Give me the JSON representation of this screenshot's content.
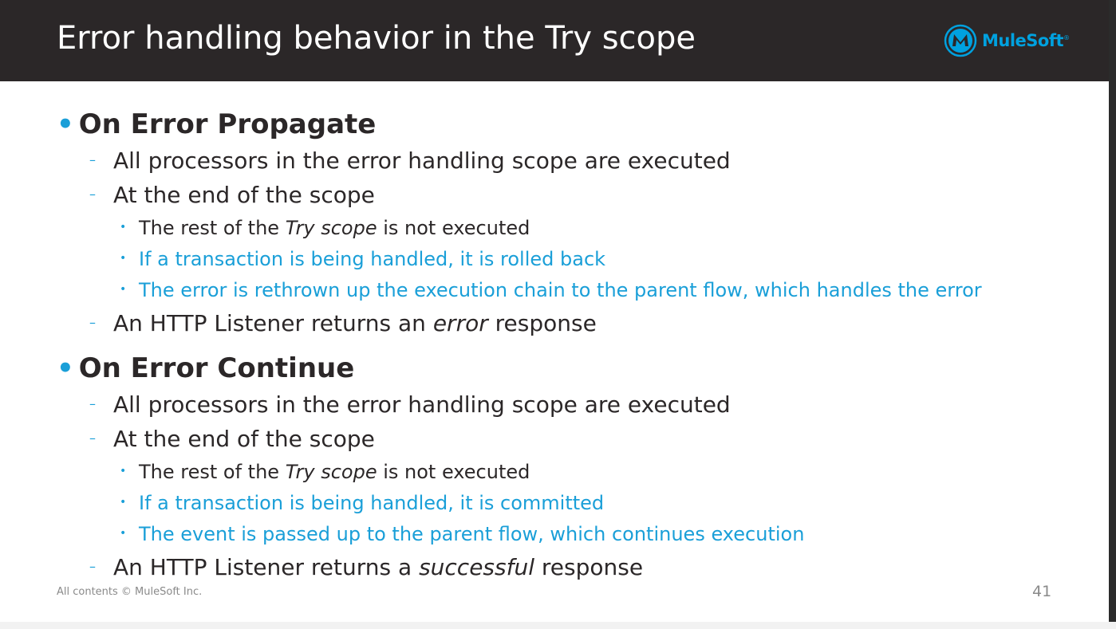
{
  "slide": {
    "title": "Error handling behavior in the Try scope",
    "logo_text": "MuleSoft",
    "footer": "All contents © MuleSoft Inc.",
    "page_number": "41"
  },
  "propagate": {
    "heading": "On Error Propagate",
    "item1": "All processors in the error handling scope are executed",
    "item2": "At the end of the scope",
    "sub1_pre": "The rest of the ",
    "sub1_em": "Try scope",
    "sub1_post": " is not executed",
    "sub2": "If a transaction is being handled, it is rolled back",
    "sub3": "The error is rethrown up the execution chain to the parent flow, which handles the error",
    "item3_pre": "An HTTP Listener returns an ",
    "item3_em": "error",
    "item3_post": " response"
  },
  "continue": {
    "heading": "On Error Continue",
    "item1": "All processors in the error handling scope are executed",
    "item2": "At the end of the scope",
    "sub1_pre": "The rest of the ",
    "sub1_em": "Try scope",
    "sub1_post": " is not executed",
    "sub2": "If a transaction is being handled, it is committed",
    "sub3": "The event is passed up to the parent flow, which continues execution",
    "item3_pre": "An HTTP Listener returns a ",
    "item3_em": "successful",
    "item3_post": " response"
  },
  "symbols": {
    "bullet": "•",
    "dash": "–",
    "dot": "•"
  },
  "colors": {
    "header_bg": "#2b2728",
    "accent_blue": "#1a9fd8",
    "text": "#2b2728"
  }
}
